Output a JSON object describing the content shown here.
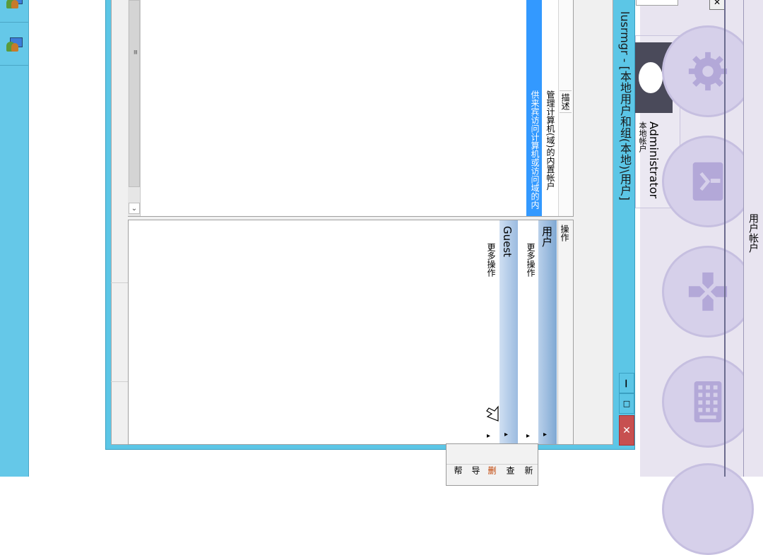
{
  "window": {
    "title": "lusrmgr - [本地用户和组(本地)\\用户]",
    "minimize_symbol": "—",
    "maximize_symbol": "□",
    "close_symbol": "✕"
  },
  "list": {
    "columns": {
      "description": "描述"
    },
    "rows": [
      {
        "name": "Administrator",
        "description": "管理计算机(域)的内置帐户",
        "selected": false
      },
      {
        "name": "Guest",
        "description": "供来宾访问计算机或访问域的内",
        "selected": true
      }
    ],
    "scroll_grip": "≡",
    "scroll_down_arrow": "⌄"
  },
  "actions": {
    "header": "操作",
    "sections": [
      {
        "title": "用户",
        "more_label": "更多操作",
        "arrow": "▸",
        "more_arrow": "▸"
      },
      {
        "title": "Guest",
        "more_label": "更多操作",
        "arrow": "▸",
        "more_arrow": "▸"
      }
    ]
  },
  "context_menu": {
    "items": [
      "新",
      "查",
      "删",
      "导",
      "帮"
    ]
  },
  "start_panel": {
    "title": "用户帐户",
    "user": {
      "name": "Administrator",
      "type": "本地帐户"
    },
    "tiles": [
      "settings-icon",
      "shutdown-icon",
      "gamepad-icon",
      "keyboard-icon"
    ],
    "close_symbol": "✕"
  },
  "colors": {
    "taskbar": "#65c8e8",
    "window_frame": "#5cc6e6",
    "selection": "#3399ff",
    "close_button": "#c75050",
    "start_bg": "#e8e4f0"
  }
}
